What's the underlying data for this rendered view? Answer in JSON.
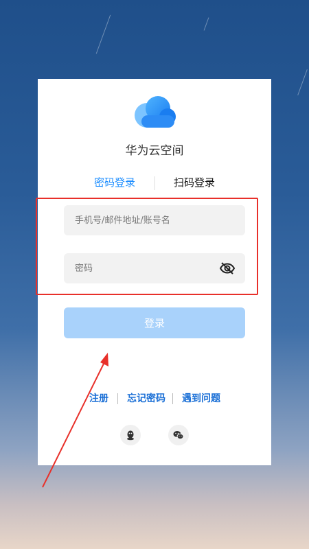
{
  "app": {
    "title": "华为云空间"
  },
  "tabs": {
    "password_login": "密码登录",
    "qr_login": "扫码登录"
  },
  "form": {
    "account_placeholder": "手机号/邮件地址/账号名",
    "password_placeholder": "密码",
    "login_button": "登录"
  },
  "links": {
    "register": "注册",
    "forgot_password": "忘记密码",
    "problem": "遇到问题"
  },
  "social": [
    {
      "icon": "qq-icon"
    },
    {
      "icon": "wechat-icon"
    }
  ],
  "annotation": {
    "highlight_color": "#e8302a"
  },
  "colors": {
    "accent": "#1a8cff",
    "button_disabled": "#a9d2fb"
  }
}
